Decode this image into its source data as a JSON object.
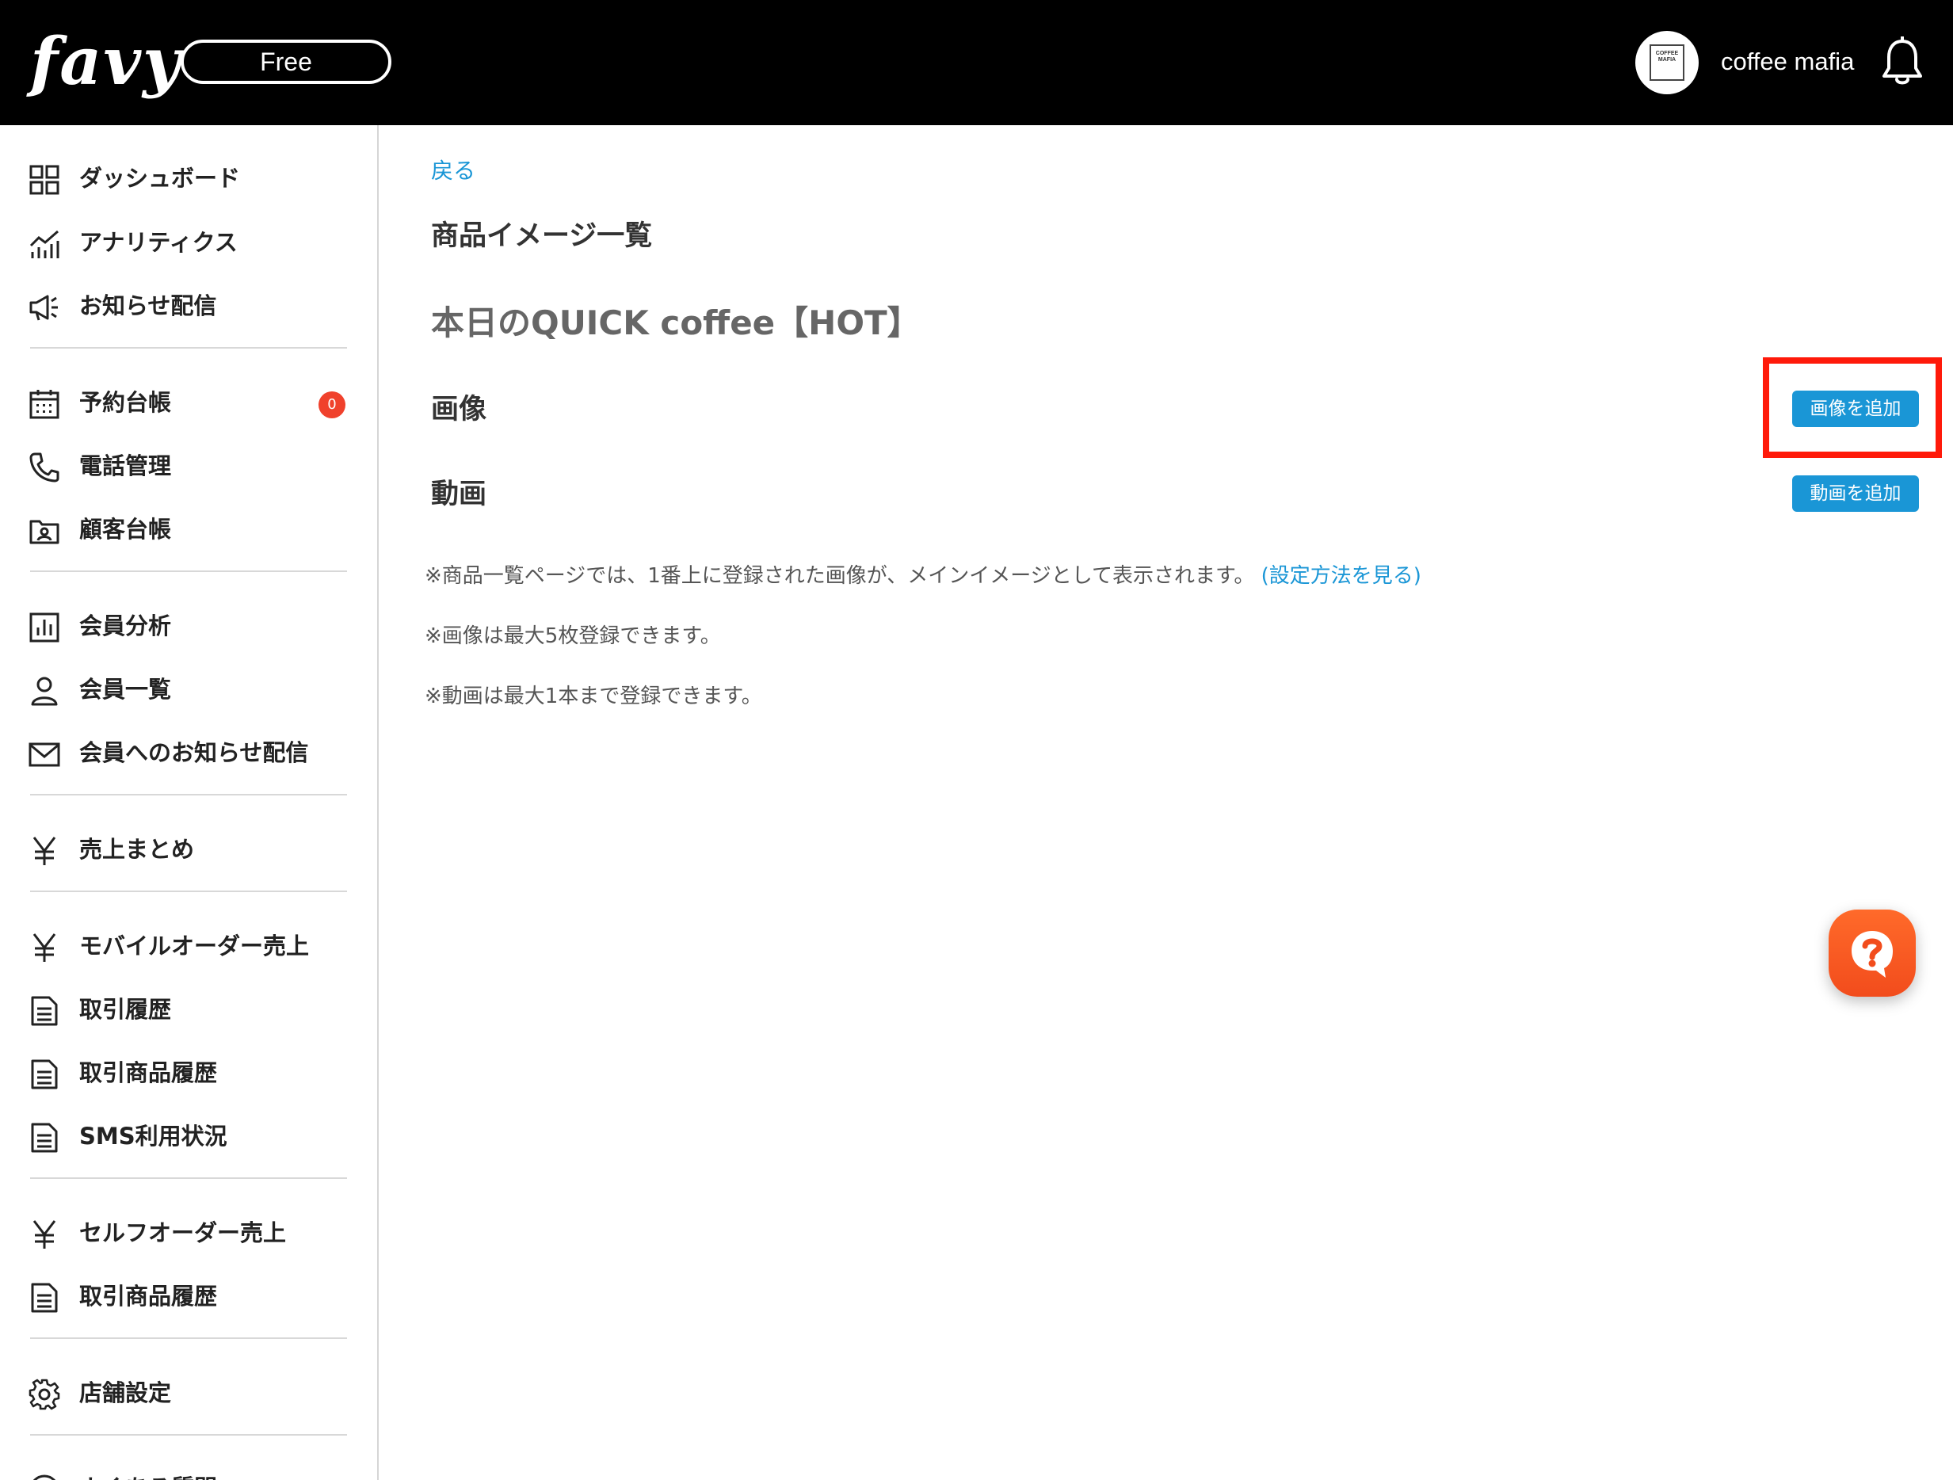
{
  "header": {
    "logo": "favy",
    "plan": "Free",
    "account_name": "coffee mafia",
    "avatar_text": "COFFEE MAFIA"
  },
  "sidebar": {
    "items": [
      {
        "label": "ダッシュボード",
        "icon": "grid-icon"
      },
      {
        "label": "アナリティクス",
        "icon": "chart-icon"
      },
      {
        "label": "お知らせ配信",
        "icon": "megaphone-icon"
      },
      {
        "label": "予約台帳",
        "icon": "calendar-icon",
        "badge": "0"
      },
      {
        "label": "電話管理",
        "icon": "phone-icon"
      },
      {
        "label": "顧客台帳",
        "icon": "contact-folder-icon"
      },
      {
        "label": "会員分析",
        "icon": "bar-chart-icon"
      },
      {
        "label": "会員一覧",
        "icon": "person-icon"
      },
      {
        "label": "会員へのお知らせ配信",
        "icon": "mail-icon"
      },
      {
        "label": "売上まとめ",
        "icon": "yen-icon"
      },
      {
        "label": "モバイルオーダー売上",
        "icon": "yen-icon"
      },
      {
        "label": "取引履歴",
        "icon": "document-icon"
      },
      {
        "label": "取引商品履歴",
        "icon": "document-icon"
      },
      {
        "label": "SMS利用状況",
        "icon": "document-icon"
      },
      {
        "label": "セルフオーダー売上",
        "icon": "yen-icon"
      },
      {
        "label": "取引商品履歴",
        "icon": "document-icon"
      },
      {
        "label": "店舗設定",
        "icon": "gear-icon"
      },
      {
        "label": "よくある質問",
        "icon": "help-circle-icon"
      }
    ]
  },
  "main": {
    "back_label": "戻る",
    "page_title": "商品イメージ一覧",
    "product_name": "本日のQUICK coffee【HOT】",
    "image_section_label": "画像",
    "add_image_label": "画像を追加",
    "video_section_label": "動画",
    "add_video_label": "動画を追加",
    "note_main_image": "※商品一覧ページでは、1番上に登録された画像が、メインイメージとして表示されます。",
    "note_help_link": "(設定方法を見る)",
    "note_image_limit": "※画像は最大5枚登録できます。",
    "note_video_limit": "※動画は最大1本まで登録できます。"
  },
  "colors": {
    "accent": "#1a96d6",
    "header_bg": "#000000",
    "badge": "#f0412c",
    "highlight": "#ff1a0a",
    "help_button": "#f5521f"
  }
}
